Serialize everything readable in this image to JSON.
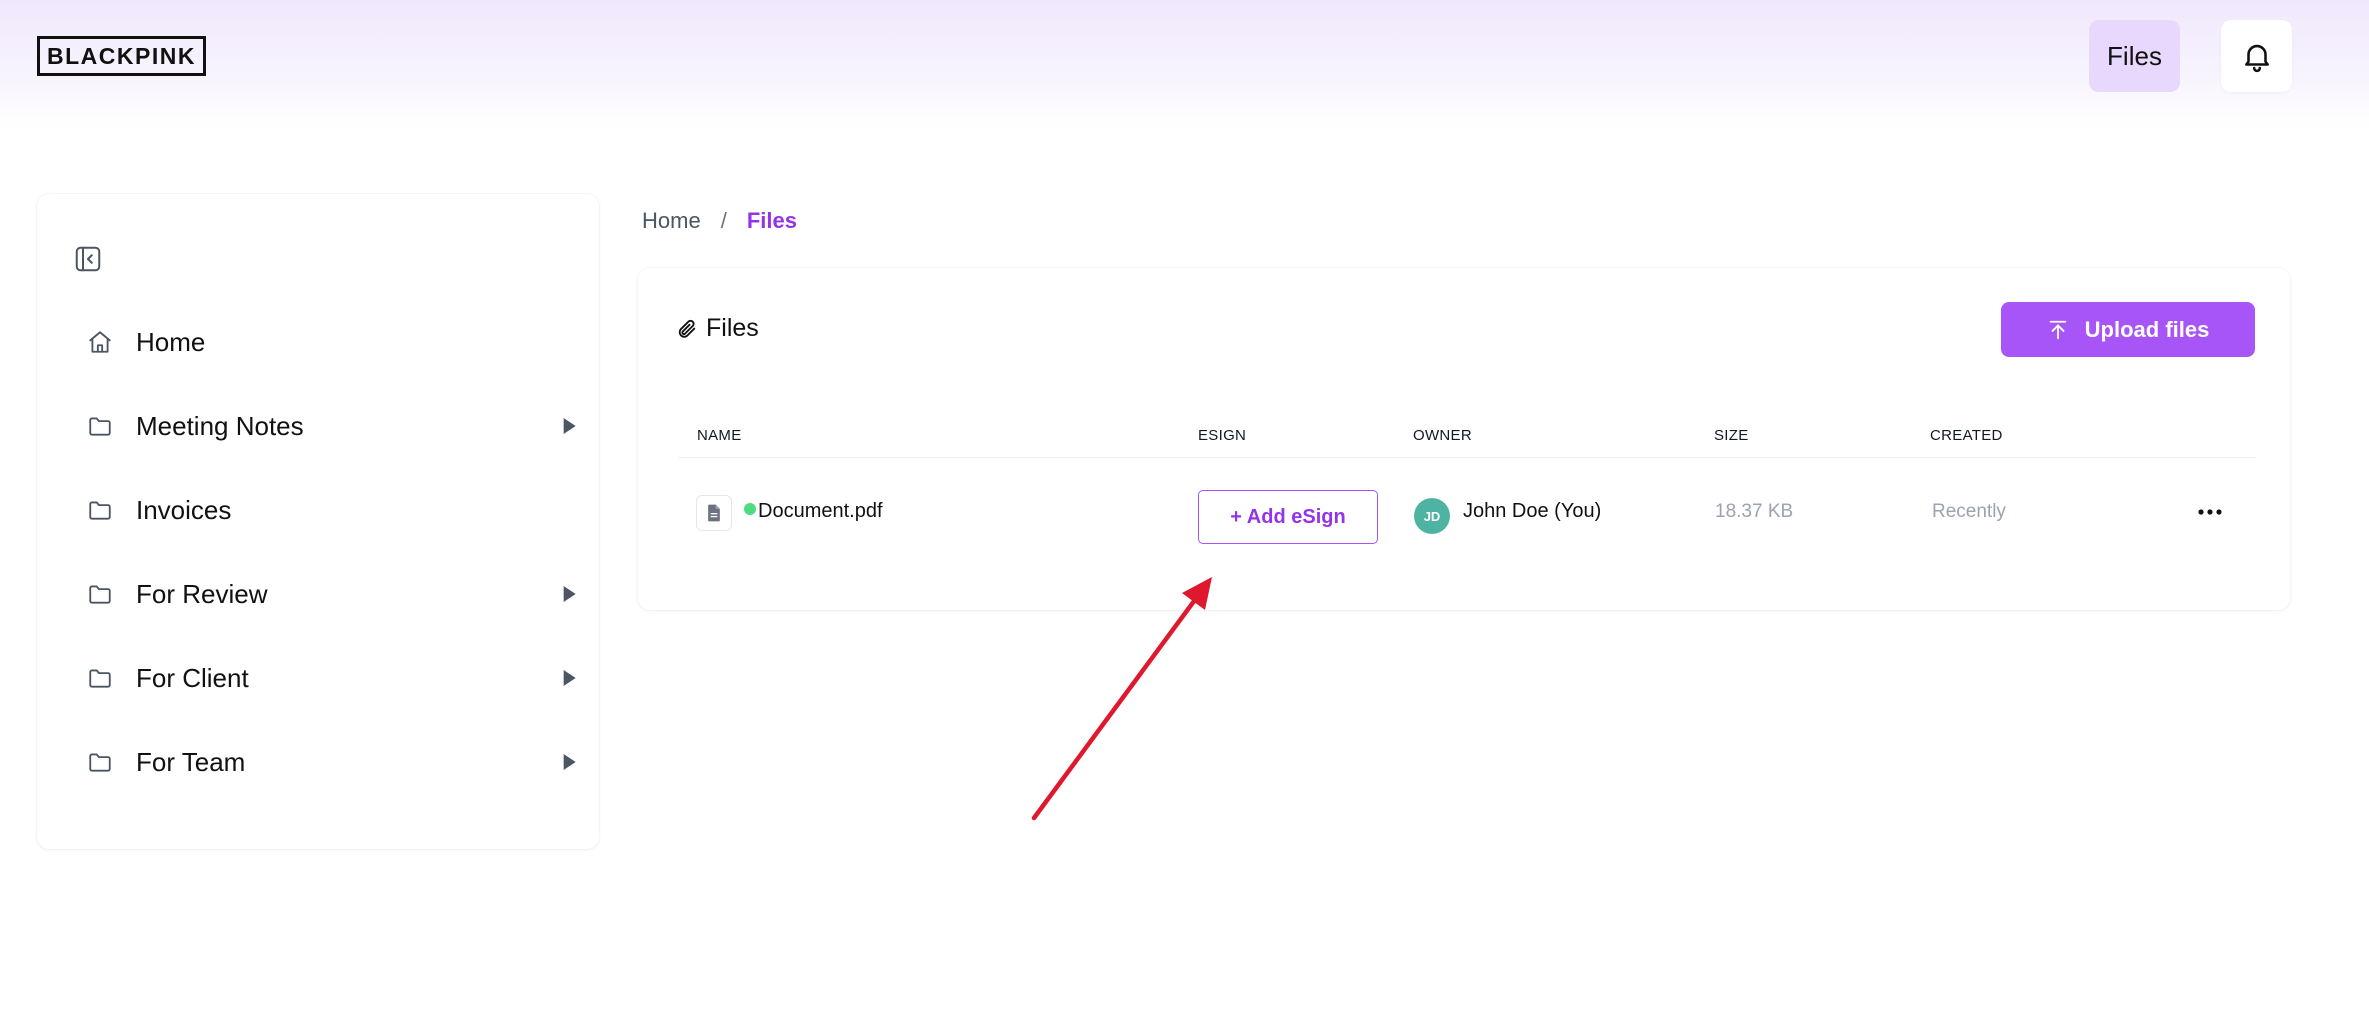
{
  "header": {
    "logo_text": "BLACKPINK",
    "files_button_label": "Files",
    "bell_icon": "bell-icon"
  },
  "sidebar": {
    "collapse_icon": "sidebar-collapse-icon",
    "items": [
      {
        "label": "Home",
        "icon": "home-icon",
        "has_submenu": false
      },
      {
        "label": "Meeting Notes",
        "icon": "folder-icon",
        "has_submenu": true
      },
      {
        "label": "Invoices",
        "icon": "folder-icon",
        "has_submenu": false
      },
      {
        "label": "For Review",
        "icon": "folder-icon",
        "has_submenu": true
      },
      {
        "label": "For Client",
        "icon": "folder-icon",
        "has_submenu": true
      },
      {
        "label": "For Team",
        "icon": "folder-icon",
        "has_submenu": true
      }
    ]
  },
  "breadcrumb": {
    "home": "Home",
    "separator": "/",
    "current": "Files"
  },
  "files_card": {
    "title": "Files",
    "title_icon": "paperclip-icon",
    "upload_label": "Upload files",
    "upload_icon": "upload-icon",
    "columns": [
      "NAME",
      "ESIGN",
      "OWNER",
      "SIZE",
      "CREATED"
    ],
    "rows": [
      {
        "name": "Document.pdf",
        "esign_label": "+ Add eSign",
        "owner_initials": "JD",
        "owner_name": "John Doe (You)",
        "size": "18.37 KB",
        "created": "Recently"
      }
    ]
  },
  "colors": {
    "accent": "#a855f7",
    "accent_text": "#9333ea",
    "files_nav_bg": "#e9d8fd",
    "avatar_bg": "#4fb3a3",
    "status_dot": "#4ade80",
    "annotation_arrow": "#e0182d"
  }
}
